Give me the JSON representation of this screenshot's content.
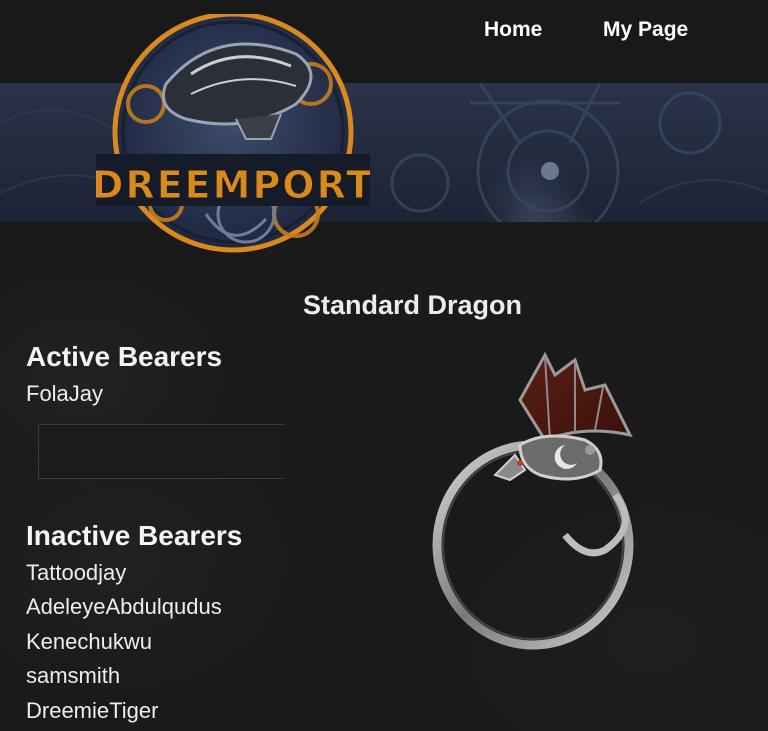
{
  "nav": {
    "home": "Home",
    "my_page": "My Page"
  },
  "logo": {
    "text": "DREEMPORT"
  },
  "page_title": "Standard Dragon",
  "active_bearers": {
    "heading": "Active Bearers",
    "names": [
      "FolaJay"
    ]
  },
  "inactive_bearers": {
    "heading": "Inactive Bearers",
    "names": [
      "Tattoodjay",
      "AdeleyeAbdulqudus",
      "Kenechukwu",
      "samsmith",
      "DreemieTiger"
    ]
  },
  "colors": {
    "background": "#1a1a1a",
    "banner": "#2b3349",
    "logo_orange": "#d98a1c"
  }
}
